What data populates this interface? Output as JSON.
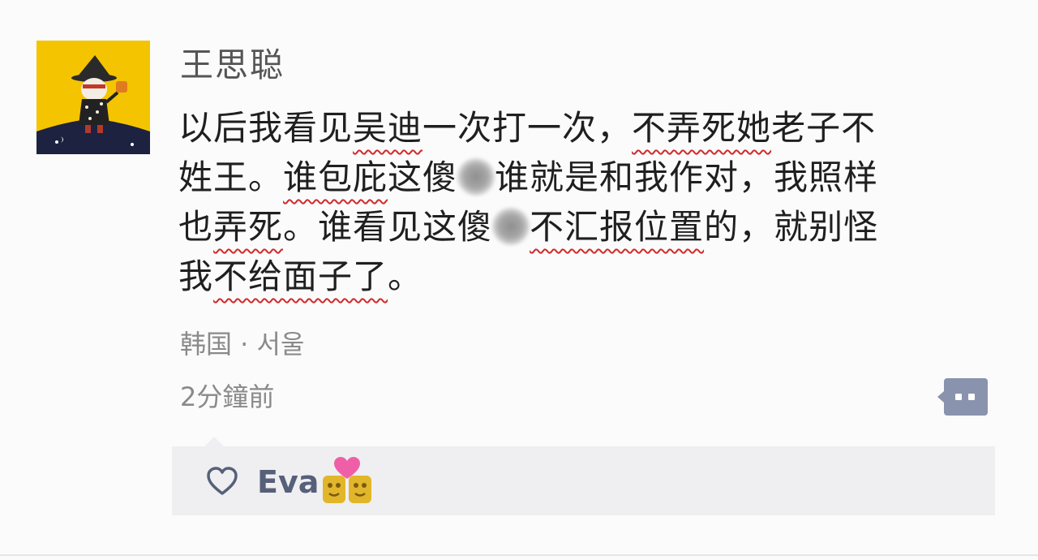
{
  "post": {
    "author": "王思聪",
    "content_lines": [
      [
        {
          "text": "以后我看见",
          "u": false
        },
        {
          "text": "吴迪",
          "u": true
        },
        {
          "text": "一次打一次，",
          "u": false
        },
        {
          "text": "不弄死她",
          "u": true
        },
        {
          "text": "老子不",
          "u": false
        }
      ],
      [
        {
          "text": "姓王。",
          "u": false
        },
        {
          "text": "谁包庇",
          "u": true
        },
        {
          "text": "这傻",
          "u": false
        },
        {
          "blur": true
        },
        {
          "text": "谁就是和我作对，我照样",
          "u": false
        }
      ],
      [
        {
          "text": "也",
          "u": false
        },
        {
          "text": "弄死",
          "u": true
        },
        {
          "text": "。谁看见这傻",
          "u": false
        },
        {
          "blur": true
        },
        {
          "text": "不汇报位置",
          "u": true
        },
        {
          "text": "的，就别怪",
          "u": false
        }
      ],
      [
        {
          "text": "我",
          "u": false
        },
        {
          "text": "不给面子了",
          "u": true
        },
        {
          "text": "。",
          "u": false
        }
      ]
    ],
    "location": "韩国 · 서울",
    "timestamp": "2分鐘前"
  },
  "likes": {
    "names": "Eva"
  },
  "icons": {
    "avatar": "cartoon-avatar",
    "comment": "comment-bubble-icon",
    "heart": "heart-outline-icon",
    "emoji": "heart-emoji-icon"
  },
  "colors": {
    "underline": "#d12a2a",
    "liker_name": "#566079",
    "meta_text": "#8a8a8a",
    "avatar_bg": "#f5c400",
    "comment_button": "#8a93ad"
  }
}
